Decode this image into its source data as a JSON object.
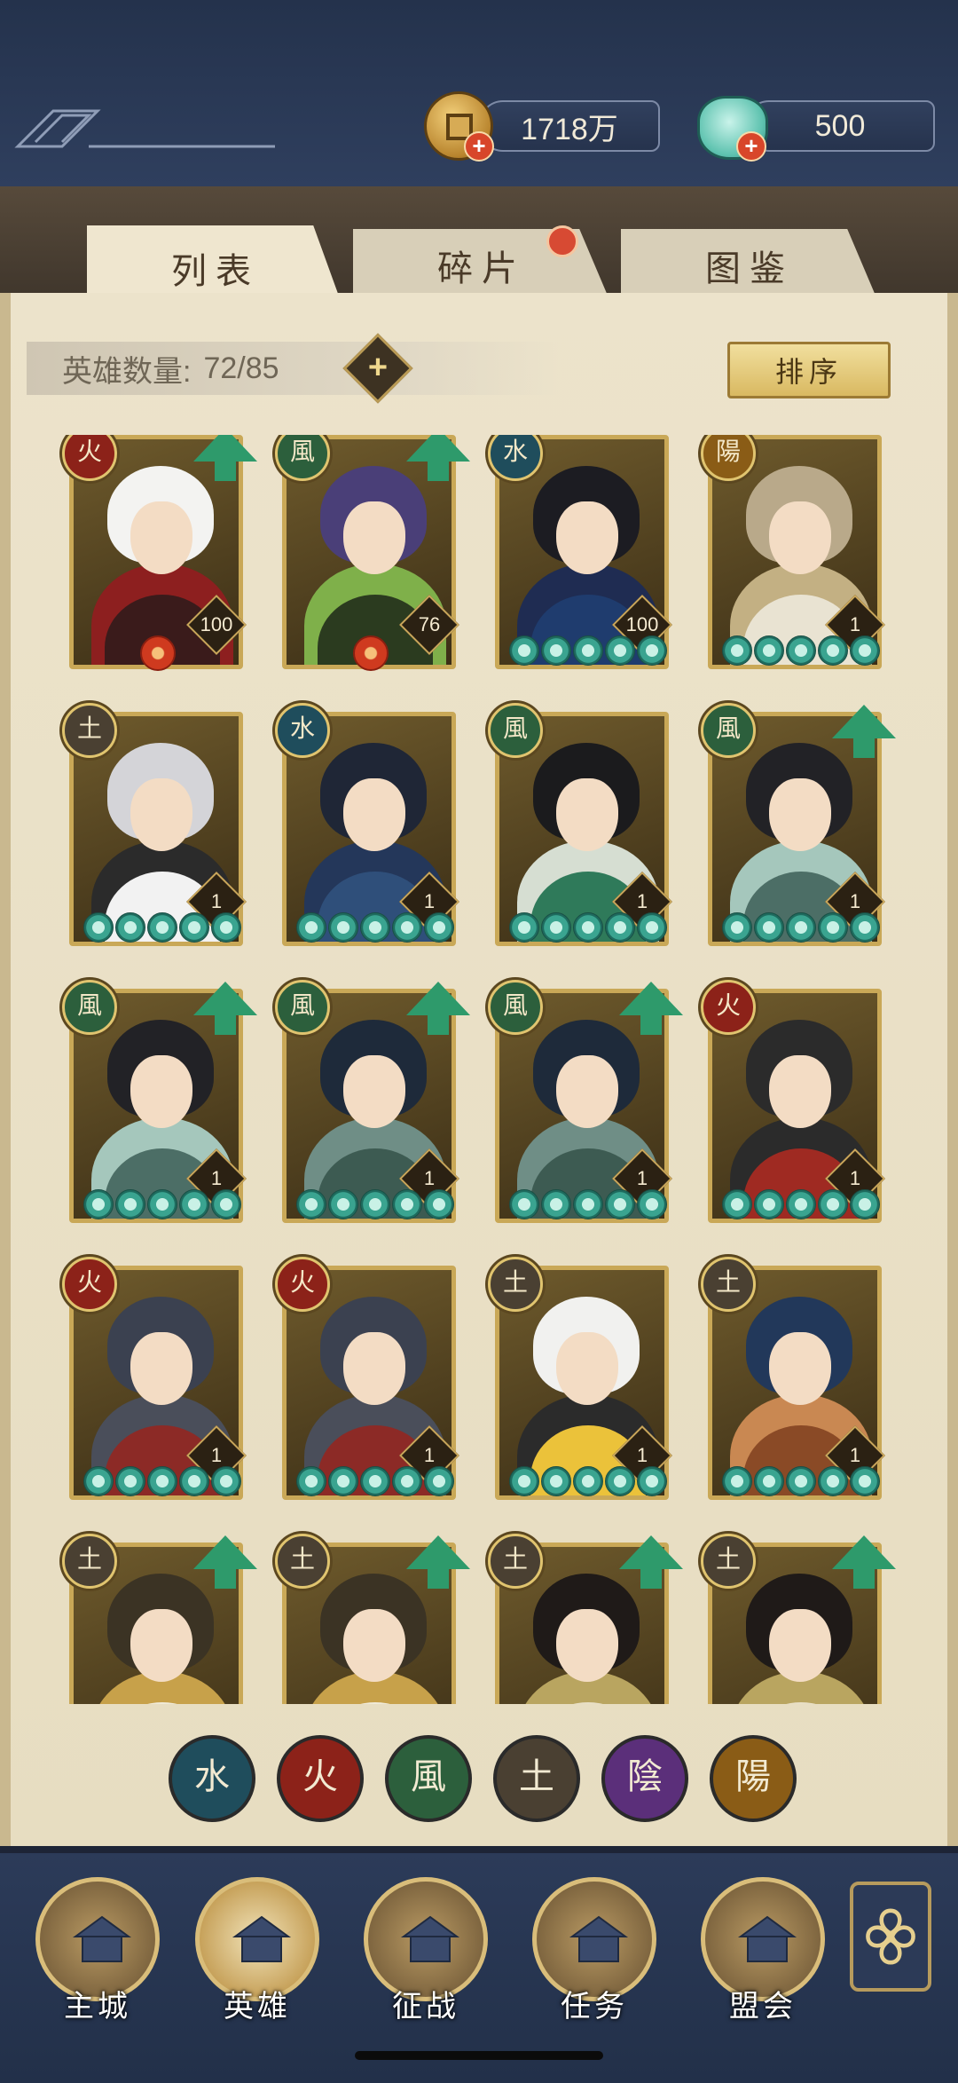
{
  "resources": {
    "copper": {
      "value": "1718万",
      "icon": "coin-icon",
      "add": "+"
    },
    "jade": {
      "value": "500",
      "icon": "jade-bag-icon",
      "add": "+"
    }
  },
  "tabs": [
    {
      "label": "列表",
      "active": true
    },
    {
      "label": "碎片",
      "active": false,
      "has_notification": true
    },
    {
      "label": "图鉴",
      "active": false
    }
  ],
  "hero_count": {
    "label": "英雄数量:",
    "value": "72/85",
    "add": "+"
  },
  "sort_label": "排序",
  "colors": {
    "fire": "#8c2219",
    "wind": "#2c5f3c",
    "water": "#1f4d5c",
    "earth": "#4a4032",
    "yin": "#5b2f7a",
    "yang": "#8a5c16",
    "card_border": "#c9a857",
    "upgrade_arrow": "#2e9a6b"
  },
  "elements": {
    "fire": "火",
    "wind": "風",
    "water": "水",
    "earth": "土",
    "yin": "陰",
    "yang": "陽"
  },
  "heroes": [
    {
      "element": "fire",
      "glyph": "火",
      "level": "100",
      "stars": 0,
      "upgrade": true,
      "awakened": true
    },
    {
      "element": "wind",
      "glyph": "風",
      "level": "76",
      "stars": 0,
      "upgrade": true,
      "awakened": true
    },
    {
      "element": "water",
      "glyph": "水",
      "level": "100",
      "stars": 5,
      "upgrade": false,
      "awakened": false
    },
    {
      "element": "yang",
      "glyph": "陽",
      "level": "1",
      "stars": 5,
      "upgrade": false,
      "awakened": false
    },
    {
      "element": "earth",
      "glyph": "土",
      "level": "1",
      "stars": 5,
      "upgrade": false,
      "awakened": false
    },
    {
      "element": "water",
      "glyph": "水",
      "level": "1",
      "stars": 5,
      "upgrade": false,
      "awakened": false
    },
    {
      "element": "wind",
      "glyph": "風",
      "level": "1",
      "stars": 5,
      "upgrade": false,
      "awakened": false
    },
    {
      "element": "wind",
      "glyph": "風",
      "level": "1",
      "stars": 5,
      "upgrade": true,
      "awakened": false
    },
    {
      "element": "wind",
      "glyph": "風",
      "level": "1",
      "stars": 5,
      "upgrade": true,
      "awakened": false
    },
    {
      "element": "wind",
      "glyph": "風",
      "level": "1",
      "stars": 5,
      "upgrade": true,
      "awakened": false
    },
    {
      "element": "wind",
      "glyph": "風",
      "level": "1",
      "stars": 5,
      "upgrade": true,
      "awakened": false
    },
    {
      "element": "fire",
      "glyph": "火",
      "level": "1",
      "stars": 5,
      "upgrade": false,
      "awakened": false
    },
    {
      "element": "fire",
      "glyph": "火",
      "level": "1",
      "stars": 5,
      "upgrade": false,
      "awakened": false
    },
    {
      "element": "fire",
      "glyph": "火",
      "level": "1",
      "stars": 5,
      "upgrade": false,
      "awakened": false
    },
    {
      "element": "earth",
      "glyph": "土",
      "level": "1",
      "stars": 5,
      "upgrade": false,
      "awakened": false
    },
    {
      "element": "earth",
      "glyph": "土",
      "level": "1",
      "stars": 5,
      "upgrade": false,
      "awakened": false
    },
    {
      "element": "earth",
      "glyph": "土",
      "level": "",
      "stars": 0,
      "upgrade": true,
      "awakened": false
    },
    {
      "element": "earth",
      "glyph": "土",
      "level": "",
      "stars": 0,
      "upgrade": true,
      "awakened": false
    },
    {
      "element": "earth",
      "glyph": "土",
      "level": "",
      "stars": 0,
      "upgrade": true,
      "awakened": false
    },
    {
      "element": "earth",
      "glyph": "土",
      "level": "",
      "stars": 0,
      "upgrade": true,
      "awakened": false
    }
  ],
  "filters": [
    {
      "element": "water",
      "glyph": "水"
    },
    {
      "element": "fire",
      "glyph": "火"
    },
    {
      "element": "wind",
      "glyph": "風"
    },
    {
      "element": "earth",
      "glyph": "土"
    },
    {
      "element": "yin",
      "glyph": "陰"
    },
    {
      "element": "yang",
      "glyph": "陽"
    }
  ],
  "nav": [
    {
      "label": "主城",
      "icon": "city-gate-icon",
      "active": false
    },
    {
      "label": "英雄",
      "icon": "hero-portrait-icon",
      "active": true
    },
    {
      "label": "征战",
      "icon": "battle-drum-icon",
      "active": false
    },
    {
      "label": "任务",
      "icon": "scroll-task-icon",
      "active": false
    },
    {
      "label": "盟会",
      "icon": "alliance-hall-icon",
      "active": false
    }
  ],
  "menu_icon": "flower-menu-icon"
}
